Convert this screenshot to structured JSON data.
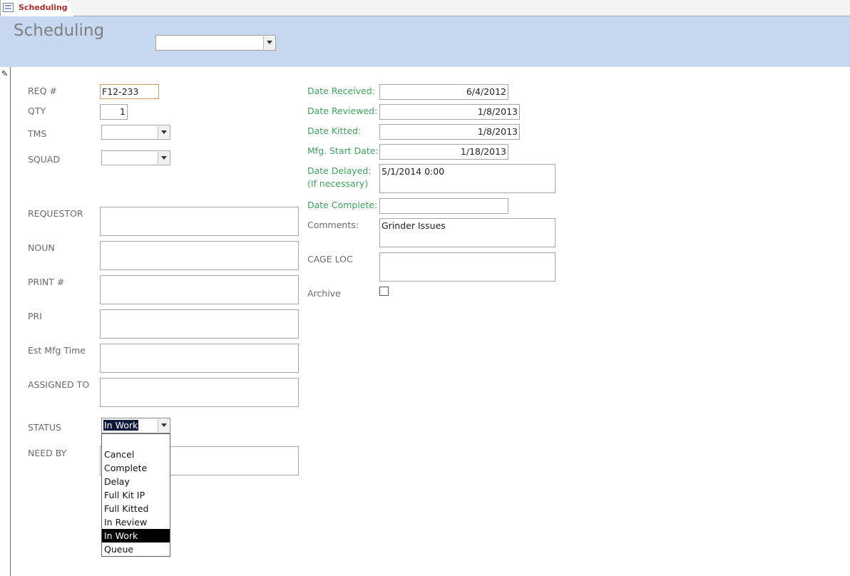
{
  "tab": {
    "label": "Scheduling"
  },
  "header": {
    "title": "Scheduling",
    "combo_value": ""
  },
  "left_fields": {
    "req": {
      "label": "REQ #",
      "value": "F12-233"
    },
    "qty": {
      "label": "QTY",
      "value": "1"
    },
    "tms": {
      "label": "TMS",
      "value": ""
    },
    "squad": {
      "label": "SQUAD",
      "value": ""
    },
    "requestor": {
      "label": "REQUESTOR",
      "value": ""
    },
    "noun": {
      "label": "NOUN",
      "value": ""
    },
    "print": {
      "label": "PRINT #",
      "value": ""
    },
    "pri": {
      "label": "PRI",
      "value": ""
    },
    "est_mfg_time": {
      "label": "Est Mfg Time",
      "value": ""
    },
    "assigned_to": {
      "label": "ASSIGNED TO",
      "value": ""
    },
    "status": {
      "label": "STATUS",
      "value": "In Work"
    },
    "need_by": {
      "label": "NEED BY",
      "value": ""
    }
  },
  "status_options": [
    "",
    "Cancel",
    "Complete",
    "Delay",
    "Full Kit IP",
    "Full Kitted",
    "In Review",
    "In Work",
    "Queue"
  ],
  "status_selected": "In Work",
  "right_fields": {
    "date_received": {
      "label": "Date Received:",
      "value": "6/4/2012"
    },
    "date_reviewed": {
      "label": "Date Reviewed:",
      "value": "1/8/2013"
    },
    "date_kitted": {
      "label": "Date Kitted:",
      "value": "1/8/2013"
    },
    "mfg_start": {
      "label": "Mfg. Start Date:",
      "value": "1/18/2013"
    },
    "date_delayed": {
      "label": "Date Delayed:",
      "label2": "(If necessary)",
      "value": "5/1/2014 0:00"
    },
    "date_complete": {
      "label": "Date Complete:",
      "value": ""
    },
    "comments": {
      "label": "Comments:",
      "value": "Grinder Issues"
    },
    "cage_loc": {
      "label": "CAGE LOC",
      "value": ""
    },
    "archive": {
      "label": "Archive",
      "checked": false
    }
  },
  "colors": {
    "header_band": "#c6d9f1",
    "green_label": "#3da35d",
    "tab_label": "#b02a2a"
  }
}
